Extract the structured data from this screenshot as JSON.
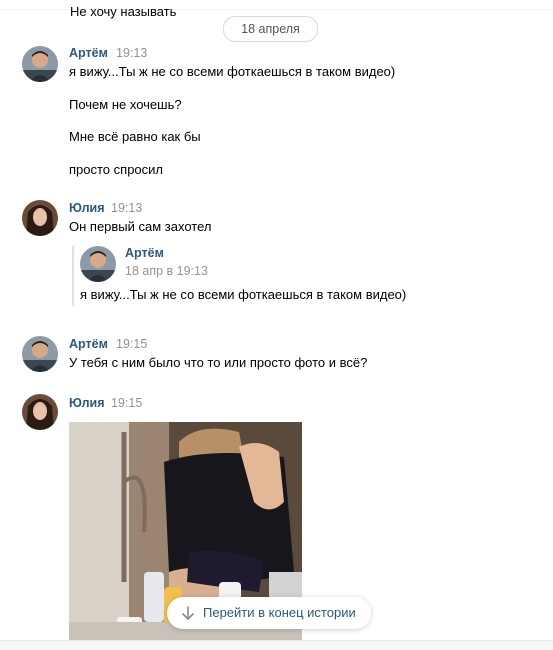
{
  "header": {
    "prev_message_tail": "Не хочу называть",
    "date_pill": "18 апреля"
  },
  "messages": [
    {
      "sender": "Артём",
      "time": "19:13",
      "lines": [
        "я вижу...Ты ж не со всеми фоткаешься в таком видео)",
        "Почем не хочешь?",
        "Мне всё равно как бы",
        "просто спросил"
      ]
    },
    {
      "sender": "Юлия",
      "time": "19:13",
      "lines": [
        "Он первый сам захотел"
      ],
      "quote": {
        "sender": "Артём",
        "date": "18 апр в 19:13",
        "text": "я вижу...Ты ж не со всеми фоткаешься в таком видео)"
      }
    },
    {
      "sender": "Артём",
      "time": "19:15",
      "lines": [
        "У тебя с ним было что то или просто фото и всё?"
      ]
    },
    {
      "sender": "Юлия",
      "time": "19:15",
      "attachment": "photo"
    }
  ],
  "jump_button": {
    "label": "Перейти в конец истории",
    "icon": "arrow-down-icon"
  },
  "colors": {
    "name_link": "#2a5885",
    "time_gray": "#939393",
    "divider": "#dae1e8"
  }
}
